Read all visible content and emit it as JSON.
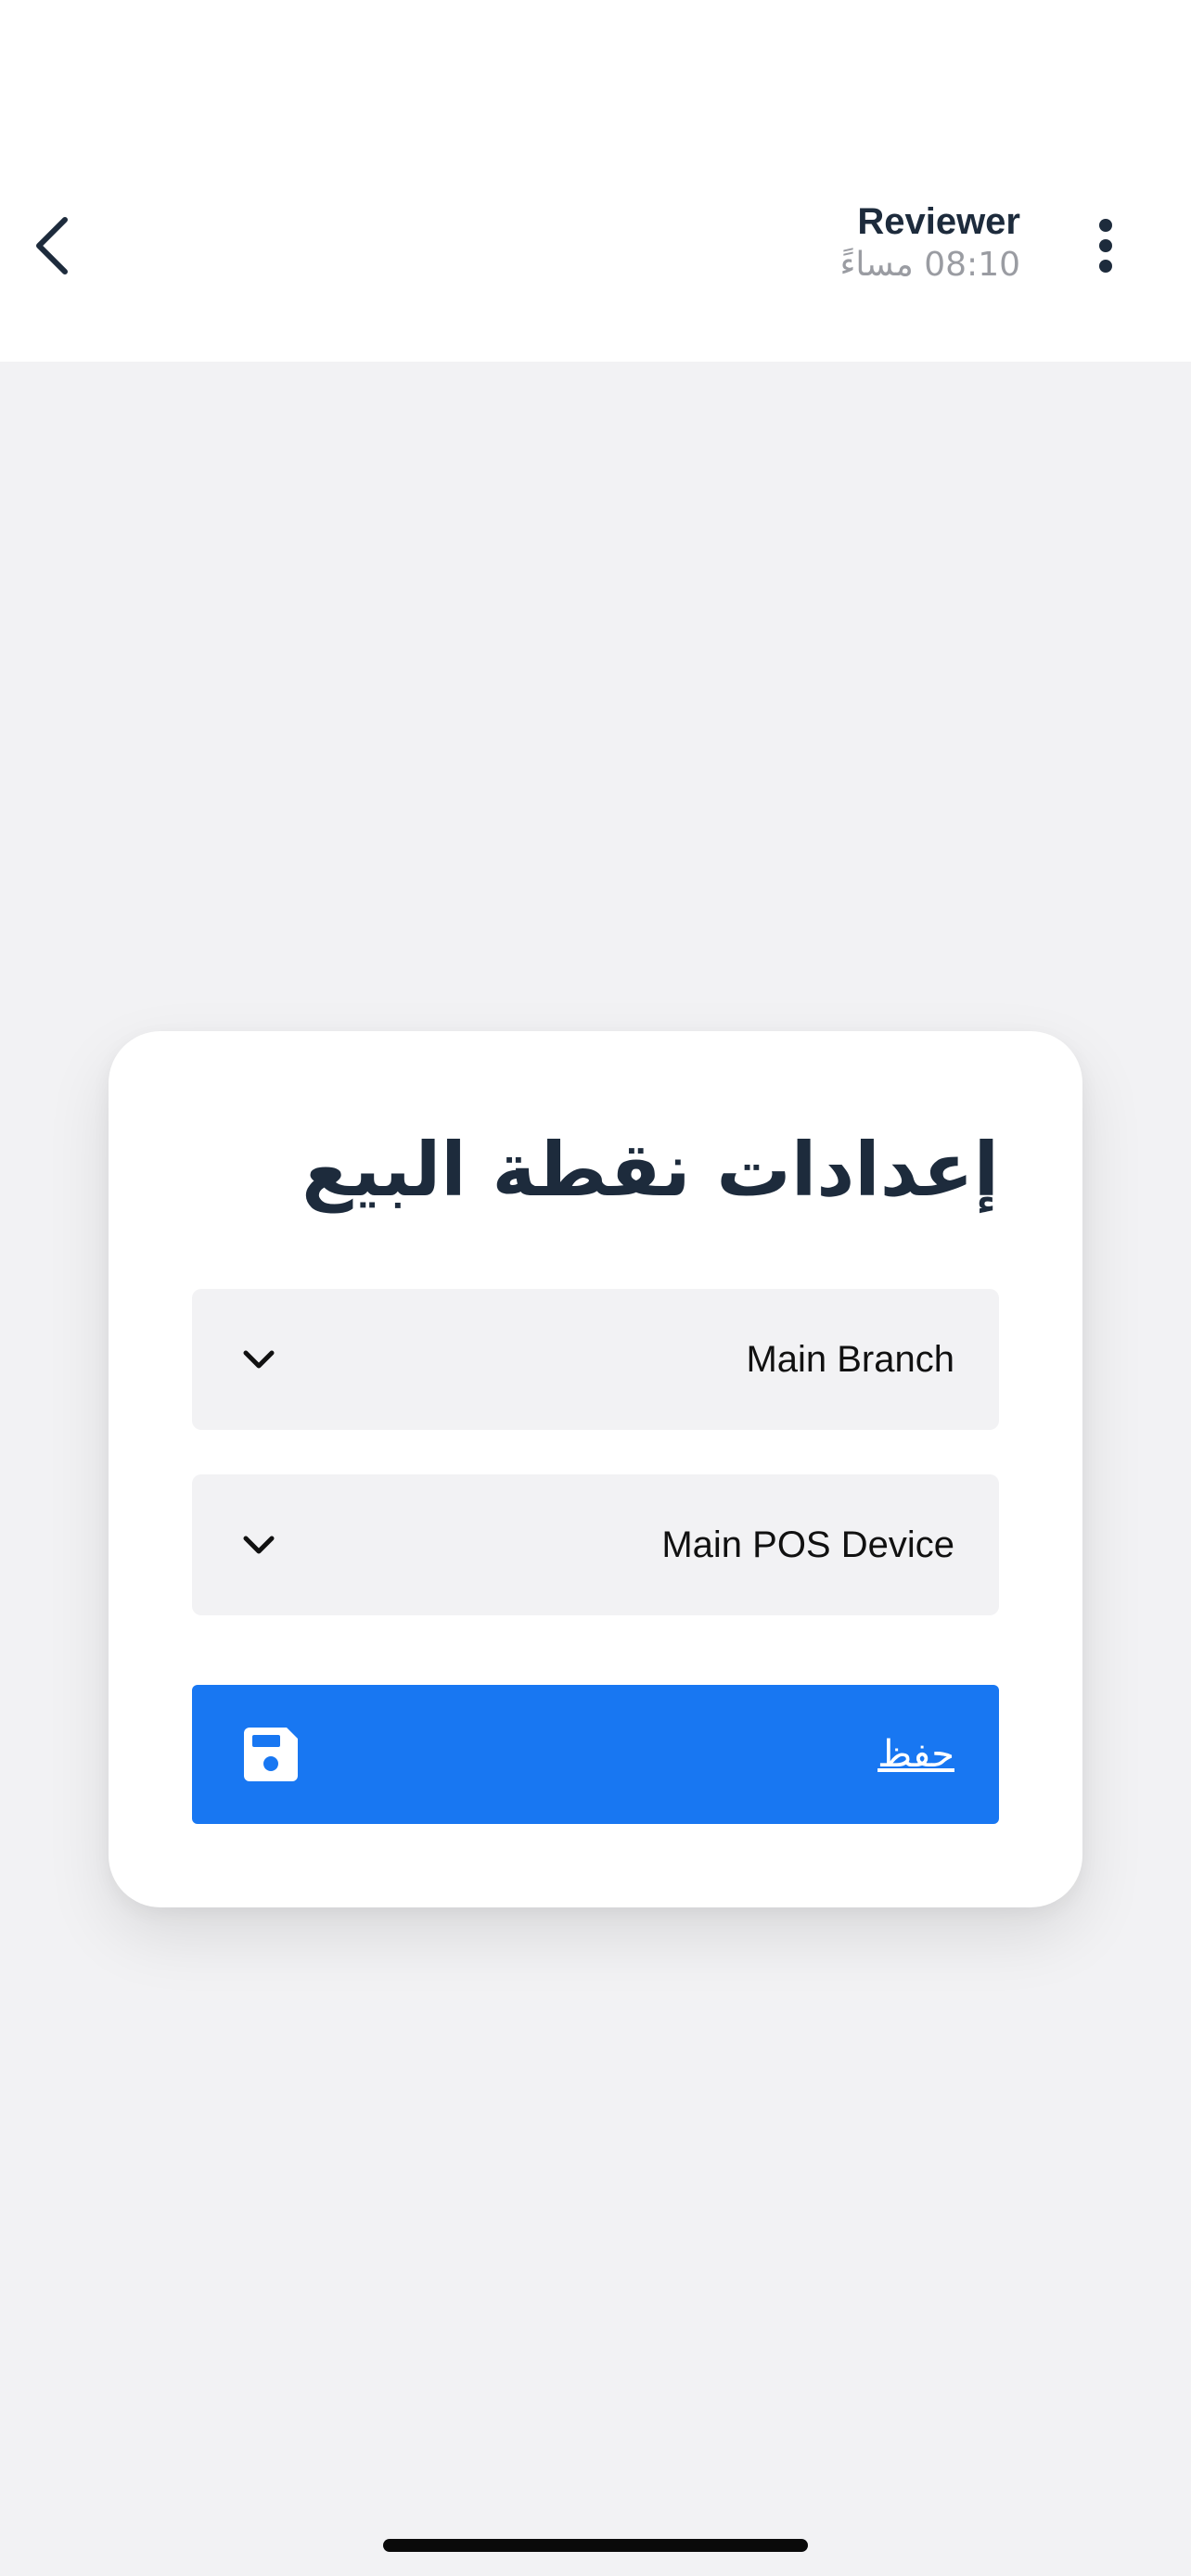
{
  "header": {
    "back_icon": "chevron-left-icon",
    "user_name": "Reviewer",
    "time": "08:10 مساءً",
    "menu_icon": "vertical-ellipsis-icon"
  },
  "card": {
    "title": "إعدادات نقطة البيع",
    "branch_select": {
      "value": "Main Branch",
      "icon": "chevron-down-icon"
    },
    "device_select": {
      "value": "Main POS Device",
      "icon": "chevron-down-icon"
    },
    "save_button": {
      "label": "حفظ",
      "icon": "floppy-disk-icon",
      "color": "#1877f2"
    }
  },
  "colors": {
    "background": "#f2f2f4",
    "text_dark": "#1d2b3c",
    "accent": "#1877f2"
  }
}
